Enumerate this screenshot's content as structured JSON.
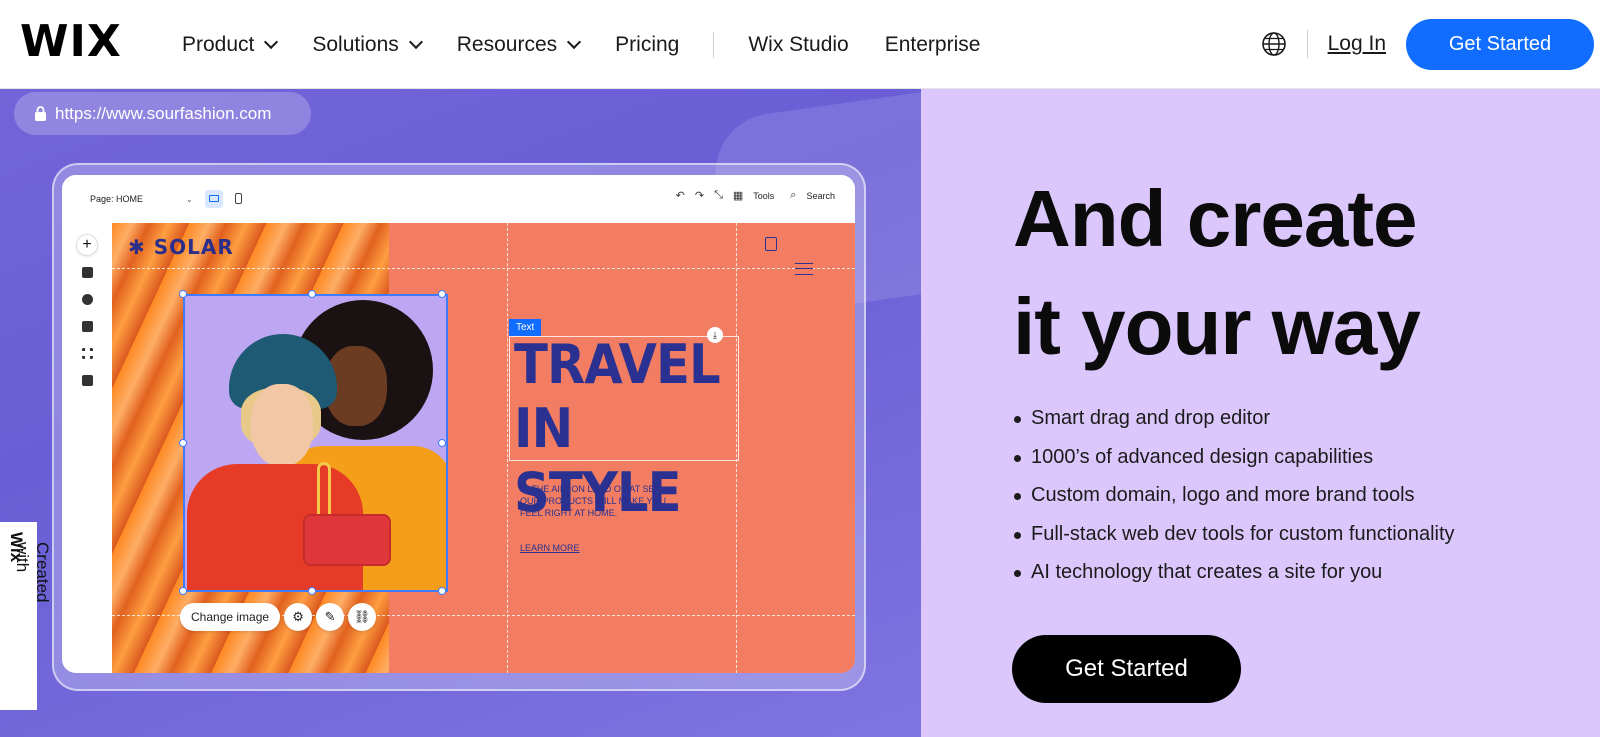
{
  "nav": {
    "logo": "WIX",
    "items": [
      {
        "label": "Product",
        "has_dropdown": true
      },
      {
        "label": "Solutions",
        "has_dropdown": true
      },
      {
        "label": "Resources",
        "has_dropdown": true
      },
      {
        "label": "Pricing",
        "has_dropdown": false
      },
      {
        "label": "Wix Studio",
        "has_dropdown": false
      },
      {
        "label": "Enterprise",
        "has_dropdown": false
      }
    ],
    "login": "Log In",
    "cta": "Get Started",
    "globe_icon": "globe-icon"
  },
  "editor_preview": {
    "url": "https://www.sourfashion.com",
    "page_selector": "Page: HOME",
    "toolbar": {
      "tools": "Tools",
      "search": "Search"
    },
    "site": {
      "logo": "✱ SOLAR",
      "text_tag": "Text",
      "headline_line1": "TRAVEL",
      "headline_line2": "IN STYLE",
      "sub_line1": "IN THE AIR, ON LAND OR AT SEA -",
      "sub_line2": "OUR PRODUCTS WILL MAKE YOU",
      "sub_line3": "FEEL RIGHT AT HOME.",
      "learn_more": "LEARN MORE"
    },
    "image_toolbar": {
      "change_image": "Change image"
    }
  },
  "badge": {
    "prefix": "Created with ",
    "brand": "Wix"
  },
  "hero": {
    "headline_line1": "And create",
    "headline_line2": "it your way",
    "features": [
      "Smart drag and drop editor",
      "1000’s of advanced design capabilities",
      "Custom domain, logo and more brand tools",
      "Full-stack web dev tools for custom functionality",
      "AI technology that creates a site for you"
    ],
    "cta": "Get Started"
  },
  "colors": {
    "accent": "#116dff",
    "left_bg": "#6d60d8",
    "right_bg": "#dbc7fb",
    "site_coral": "#f27d62",
    "site_navy": "#2a3190"
  }
}
